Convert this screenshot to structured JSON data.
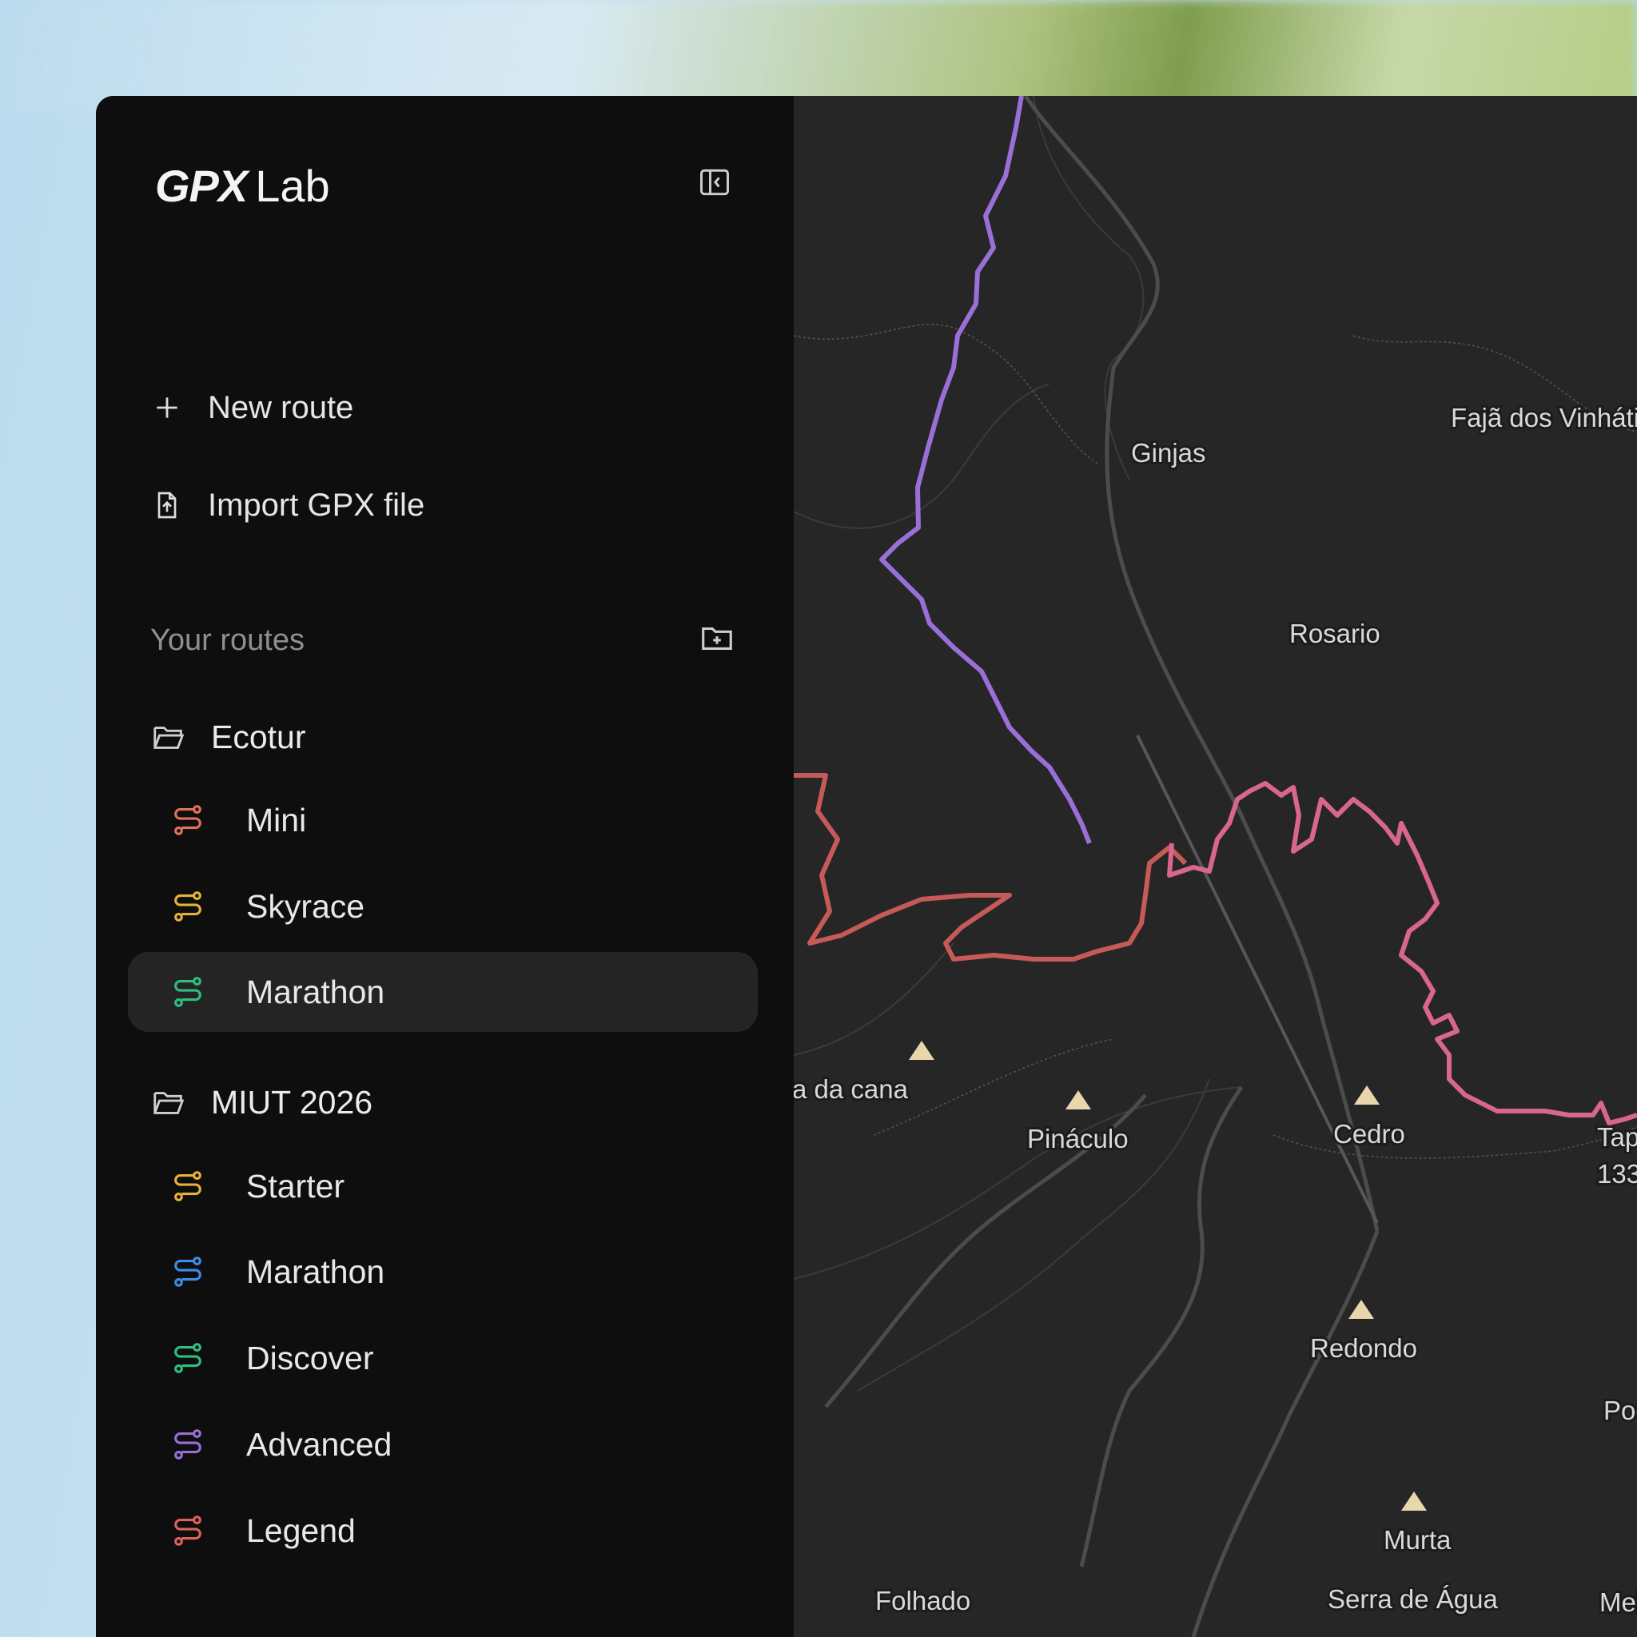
{
  "app": {
    "logo_bold": "GPX",
    "logo_light": "Lab"
  },
  "actions": {
    "new_route": "New route",
    "import_gpx": "Import GPX file"
  },
  "routes_section": {
    "label": "Your routes"
  },
  "folders": [
    {
      "name": "Ecotur",
      "routes": [
        {
          "name": "Mini",
          "color": "#e0715a"
        },
        {
          "name": "Skyrace",
          "color": "#e6b33a"
        },
        {
          "name": "Marathon",
          "color": "#2fbf7f",
          "active": true
        }
      ]
    },
    {
      "name": "MIUT 2026",
      "routes": [
        {
          "name": "Starter",
          "color": "#e6b33a"
        },
        {
          "name": "Marathon",
          "color": "#3b8ee8"
        },
        {
          "name": "Discover",
          "color": "#2fbf7f"
        },
        {
          "name": "Advanced",
          "color": "#9a6fd8"
        },
        {
          "name": "Legend",
          "color": "#e0605a"
        }
      ]
    }
  ],
  "map": {
    "places": {
      "ginjas": "Ginjas",
      "faja": "Fajã dos Vinháticos",
      "rosario": "Rosario",
      "da_cana": "a da cana",
      "pinaculo": "Pináculo",
      "cedro": "Cedro",
      "tap": "Tap",
      "tap_num": "133",
      "redondo": "Redondo",
      "pocinha": "Pocinha",
      "murta": "Murta",
      "meio": "Meio-Vintér",
      "serra": "Serra de Água",
      "folhado": "Folhado"
    },
    "track_colors": {
      "purple": "#9a6fd8",
      "red": "#c65a57",
      "pink": "#d9668e"
    }
  }
}
